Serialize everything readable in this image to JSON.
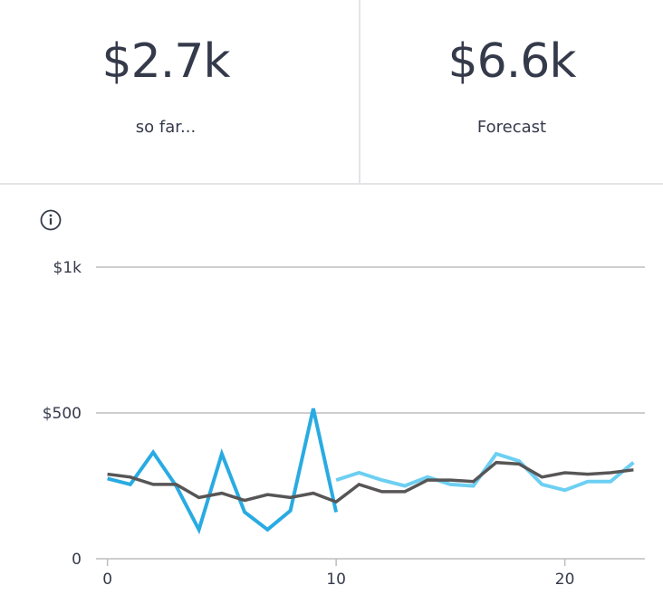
{
  "stats": {
    "so_far": {
      "value": "$2.7k",
      "label": "so far..."
    },
    "forecast": {
      "value": "$6.6k",
      "label": "Forecast"
    }
  },
  "icons": {
    "info": "info-icon"
  },
  "colors": {
    "actual": "#29abe2",
    "forecast_line": "#6dcff2",
    "average": "#575555",
    "gridline": "#bdbdbd"
  },
  "chart_data": {
    "type": "line",
    "x_ticks": [
      "0",
      "10",
      "20"
    ],
    "x_tick_values": [
      0,
      10,
      20
    ],
    "y_ticks": [
      "0",
      "$500",
      "$1k"
    ],
    "y_tick_values": [
      0,
      500,
      1000
    ],
    "xlim": [
      -0.5,
      23.5
    ],
    "ylim": [
      0,
      1000
    ],
    "grid": true,
    "series": [
      {
        "key": "actual",
        "x": [
          0,
          1,
          2,
          3,
          4,
          5,
          6,
          7,
          8,
          9,
          10
        ],
        "values": [
          275,
          255,
          365,
          250,
          100,
          360,
          160,
          100,
          165,
          515,
          160
        ]
      },
      {
        "key": "forecast",
        "x": [
          10,
          11,
          12,
          13,
          14,
          15,
          16,
          17,
          18,
          19,
          20,
          21,
          22,
          23
        ],
        "values": [
          270,
          295,
          270,
          250,
          280,
          255,
          250,
          360,
          335,
          255,
          235,
          265,
          265,
          330
        ]
      },
      {
        "key": "average",
        "x": [
          0,
          1,
          2,
          3,
          4,
          5,
          6,
          7,
          8,
          9,
          10,
          11,
          12,
          13,
          14,
          15,
          16,
          17,
          18,
          19,
          20,
          21,
          22,
          23
        ],
        "values": [
          290,
          280,
          255,
          255,
          210,
          225,
          200,
          220,
          210,
          225,
          195,
          255,
          230,
          230,
          270,
          270,
          265,
          330,
          325,
          280,
          295,
          290,
          295,
          305
        ]
      }
    ]
  }
}
